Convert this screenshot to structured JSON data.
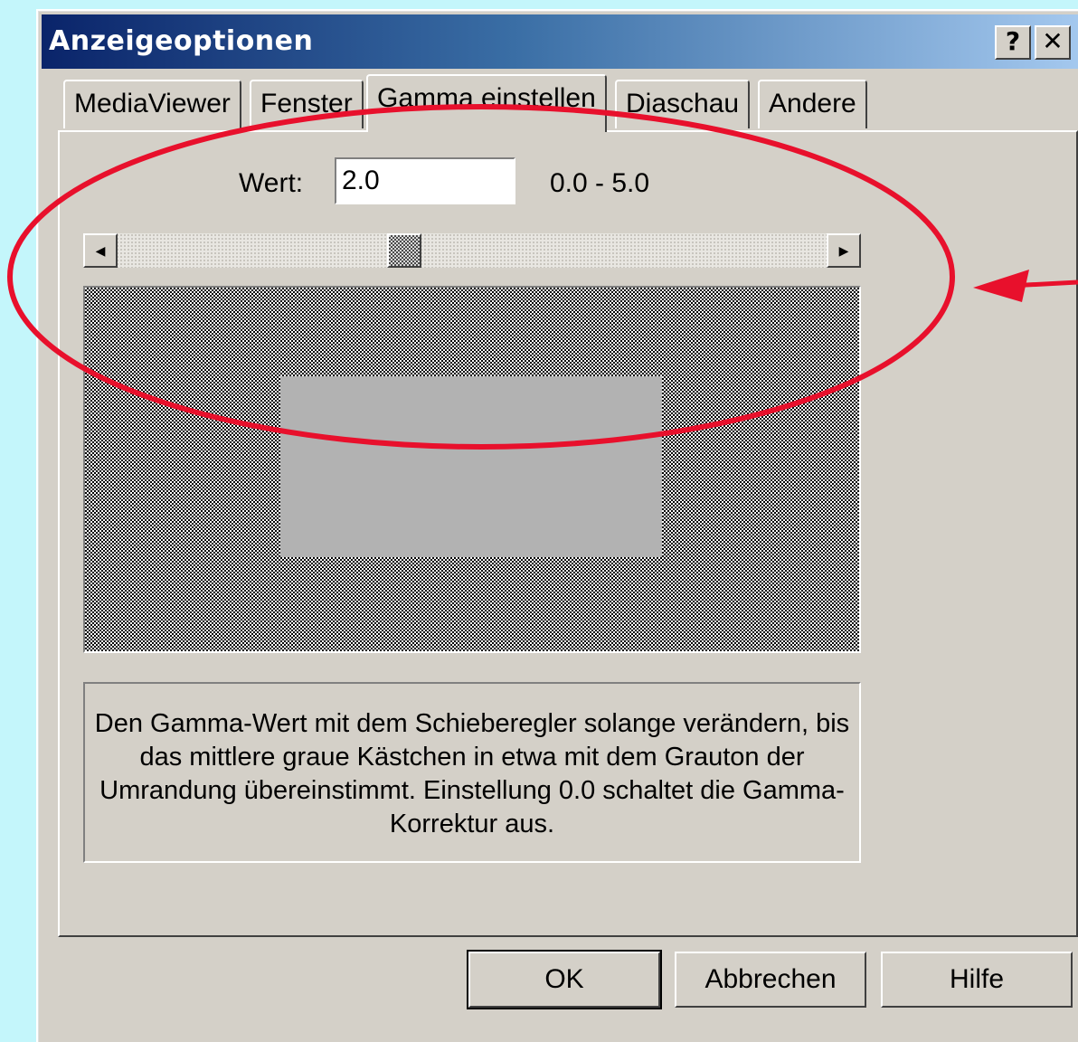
{
  "window": {
    "title": "Anzeigeoptionen",
    "help_button": "?",
    "close_button": "✕"
  },
  "tabs": [
    {
      "label": "MediaViewer",
      "active": false
    },
    {
      "label": "Fenster",
      "active": false
    },
    {
      "label": "Gamma einstellen",
      "active": true
    },
    {
      "label": "Diaschau",
      "active": false
    },
    {
      "label": "Andere",
      "active": false
    }
  ],
  "gamma": {
    "value_label": "Wert:",
    "value": "2.0",
    "range": "0.0 - 5.0",
    "slider_fraction": 0.4
  },
  "description": "Den Gamma-Wert mit dem Schieberegler solange verändern, bis das mittlere graue Kästchen in etwa mit dem Grauton der Umrandung übereinstimmt. Einstellung 0.0 schaltet die Gamma-Korrektur aus.",
  "buttons": {
    "ok": "OK",
    "cancel": "Abbrechen",
    "help": "Hilfe"
  },
  "colors": {
    "annotation": "#e8102c",
    "title_gradient_start": "#0a246a",
    "title_gradient_end": "#a6caf0",
    "background": "#c4f6fb"
  }
}
